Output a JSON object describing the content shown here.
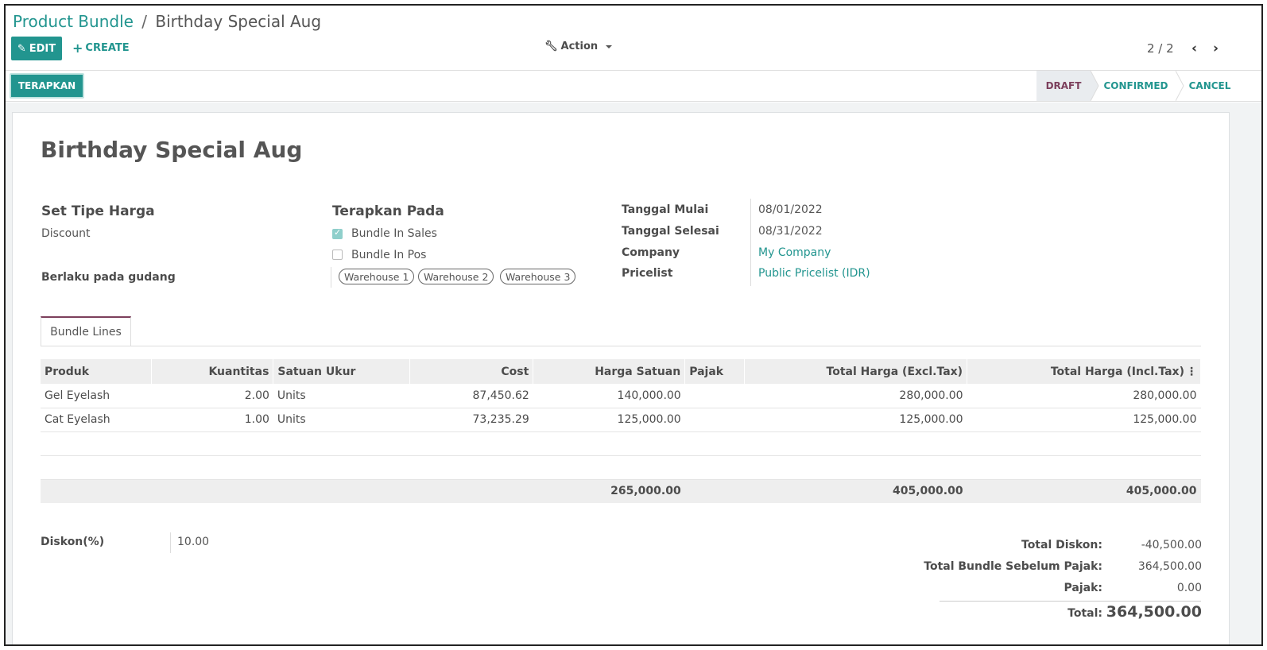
{
  "breadcrumb": {
    "parent": "Product Bundle",
    "separator": "/",
    "current": "Birthday Special Aug"
  },
  "toolbar": {
    "edit_label": "EDIT",
    "create_label": "CREATE",
    "action_label": "Action",
    "pager": "2 / 2"
  },
  "statusbar": {
    "apply_label": "TERAPKAN",
    "stages": [
      "DRAFT",
      "CONFIRMED",
      "CANCEL"
    ],
    "active_stage": "DRAFT"
  },
  "form": {
    "title": "Birthday Special Aug",
    "price_type": {
      "heading": "Set Tipe Harga",
      "value": "Discount"
    },
    "warehouse_label": "Berlaku pada gudang",
    "apply_on": {
      "heading": "Terapkan Pada",
      "bundle_in_sales": {
        "label": "Bundle In Sales",
        "checked": true
      },
      "bundle_in_pos": {
        "label": "Bundle In Pos",
        "checked": false
      }
    },
    "warehouses": [
      "Warehouse 1",
      "Warehouse 2",
      "Warehouse 3"
    ],
    "start_date": {
      "label": "Tanggal Mulai",
      "value": "08/01/2022"
    },
    "end_date": {
      "label": "Tanggal Selesai",
      "value": "08/31/2022"
    },
    "company": {
      "label": "Company",
      "value": "My Company"
    },
    "pricelist": {
      "label": "Pricelist",
      "value": "Public Pricelist (IDR)"
    }
  },
  "tabs": [
    "Bundle Lines"
  ],
  "table": {
    "headers": [
      "Produk",
      "Kuantitas",
      "Satuan Ukur",
      "Cost",
      "Harga Satuan",
      "Pajak",
      "Total Harga (Excl.Tax)",
      "Total Harga (Incl.Tax)"
    ],
    "rows": [
      [
        "Gel Eyelash",
        "2.00",
        "Units",
        "87,450.62",
        "140,000.00",
        "",
        "280,000.00",
        "280,000.00"
      ],
      [
        "Cat Eyelash",
        "1.00",
        "Units",
        "73,235.29",
        "125,000.00",
        "",
        "125,000.00",
        "125,000.00"
      ]
    ],
    "totals": {
      "harga_satuan": "265,000.00",
      "excl_tax": "405,000.00",
      "incl_tax": "405,000.00"
    }
  },
  "discount": {
    "label": "Diskon(%)",
    "value": "10.00"
  },
  "summary": {
    "total_discount": {
      "label": "Total Diskon:",
      "value": "-40,500.00"
    },
    "before_tax": {
      "label": "Total Bundle Sebelum Pajak:",
      "value": "364,500.00"
    },
    "tax": {
      "label": "Pajak:",
      "value": "0.00"
    },
    "total": {
      "label": "Total:",
      "value": "364,500.00"
    }
  },
  "colors": {
    "primary": "#22958f",
    "accent": "#7c3f5c"
  }
}
